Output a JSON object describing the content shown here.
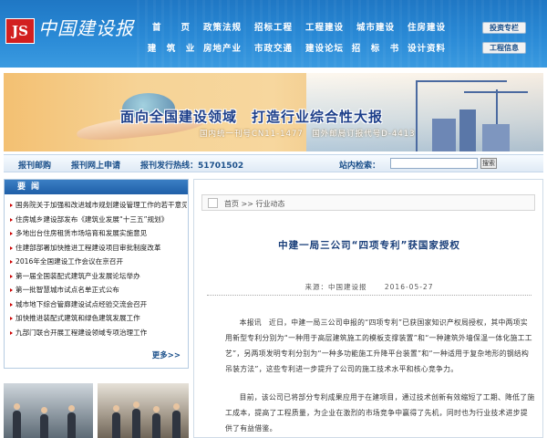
{
  "header": {
    "logo_mark": "JS",
    "logo_title": "中国建设报",
    "nav_row_1": [
      "首　　页",
      "政策法规",
      "招标工程",
      "工程建设",
      "城市建设",
      "住房建设"
    ],
    "nav_row_2": [
      "建　筑　业",
      "房地产业",
      "市政交通",
      "建设论坛",
      "招　标　书",
      "设计资料"
    ],
    "side_button_top": "投资专栏",
    "side_button_bottom": "工程信息"
  },
  "banner": {
    "slogan": "面向全国建设领域　打造行业综合性大报",
    "codes": "国内统一刊号CN11-1477　国外邮局订报代号D-4413"
  },
  "toolbar": {
    "subscribe": "报刊邮购",
    "online": "报刊网上申请",
    "phone": "报刊发行热线：51701502",
    "search_label": "站内检索：",
    "search_value": "",
    "search_button": "搜索"
  },
  "news": {
    "heading": "要闻",
    "items": [
      "国务院关于加强和改进城市规划建设管理工作的若干意见",
      "住房城乡建设部发布《建筑业发展“十三五”规划》",
      "多地出台住房租赁市场培育和发展实施意见",
      "住建部部署加快推进工程建设项目审批制度改革",
      "2016年全国建设工作会议在京召开",
      "第一届全国装配式建筑产业发展论坛举办",
      "第一批智慧城市试点名单正式公布",
      "城市地下综合管廊建设试点经验交流会召开",
      "加快推进装配式建筑和绿色建筑发展工作",
      "九部门联合开展工程建设领域专项治理工作"
    ],
    "more": "更多>>"
  },
  "article": {
    "breadcrumb": "首页 >> 行业动态",
    "title": "中建一局三公司“四项专利”获国家授权",
    "source": "来源：中国建设报",
    "date": "2016-05-27",
    "paragraph_1": "本报讯　近日，中建一局三公司申报的“四项专利”已获国家知识产权局授权，其中两项实用新型专利分别为“一种用于高层建筑施工的模板支撑装置”和“一种建筑外墙保温一体化施工工艺”，另两项发明专利分别为“一种多功能施工升降平台装置”和“一种适用于复杂地形的钢结构吊装方法”，这些专利进一步提升了公司的施工技术水平和核心竞争力。",
    "paragraph_2": "目前，该公司已将部分专利成果应用于在建项目，通过技术创新有效缩短了工期、降低了施工成本，提高了工程质量，为企业在激烈的市场竞争中赢得了先机，同时也为行业技术进步提供了有益借鉴。"
  }
}
